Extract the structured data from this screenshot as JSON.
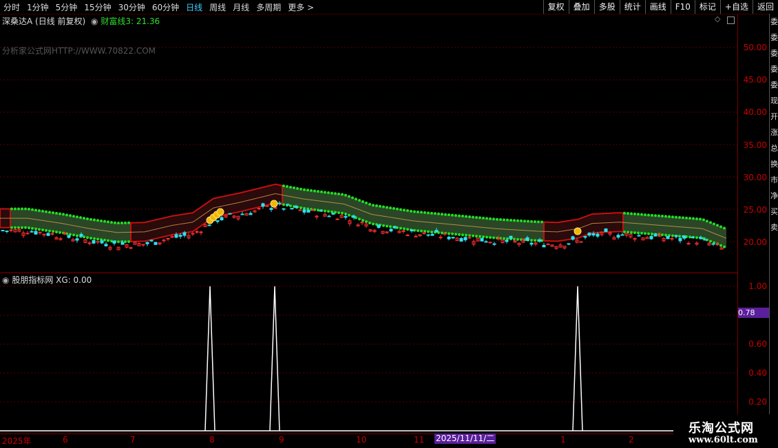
{
  "toolbar": {
    "periods": [
      "分时",
      "1分钟",
      "5分钟",
      "15分钟",
      "30分钟",
      "60分钟",
      "日线",
      "周线",
      "月线",
      "多周期",
      "更多 >"
    ],
    "active_period": "日线",
    "actions": [
      "复权",
      "叠加",
      "多股",
      "统计",
      "画线",
      "F10",
      "标记",
      "+自选",
      "返回"
    ]
  },
  "main_panel": {
    "stock_title": "深桑达A (日线 前复权)",
    "indicator_label": "财富线3: 21.36",
    "watermark": "分析家公式网HTTP://WWW.70822.COM",
    "y_ticks": [
      "50.00",
      "45.00",
      "40.00",
      "35.00",
      "30.00",
      "25.00",
      "20.00"
    ]
  },
  "sub_panel": {
    "indicator_title": "股朋指标网",
    "indicator_value": "XG: 0.00",
    "y_ticks": [
      "1.00",
      "0.60",
      "0.40",
      "0.20"
    ],
    "current_value": "0.78"
  },
  "date_axis": {
    "labels": [
      "2025年",
      "6",
      "7",
      "8",
      "9",
      "10",
      "11",
      "1",
      "2"
    ],
    "cursor_date": "2025/11/11/二"
  },
  "logo": {
    "name": "乐淘公式网",
    "url": "www.60lt.com"
  },
  "right_strip": {
    "chars": [
      "委",
      "委",
      "委",
      "委",
      "委",
      "现",
      "开",
      "涨",
      "总",
      "换",
      "市",
      "净",
      "买",
      "卖"
    ]
  },
  "colors": {
    "band_fill": "#2c4a28",
    "band_red": "#c41010",
    "band_dot": "#22dd22",
    "candle_up": "#ff3030",
    "candle_down": "#30e0f0",
    "axis_red": "#cc0000",
    "spike": "#ffffff",
    "cursor_tag": "#5a1f9a"
  },
  "chart_data": {
    "type": "line",
    "title": "",
    "series": [
      {
        "name": "XG",
        "x": [
          0,
          1,
          2,
          3,
          4,
          5,
          6,
          7,
          8,
          9,
          10,
          11,
          12
        ],
        "values": [
          0,
          0,
          0,
          1,
          0,
          0,
          0,
          1,
          0,
          0,
          0,
          1,
          0
        ]
      }
    ],
    "ylim": [
      0,
      1
    ]
  }
}
